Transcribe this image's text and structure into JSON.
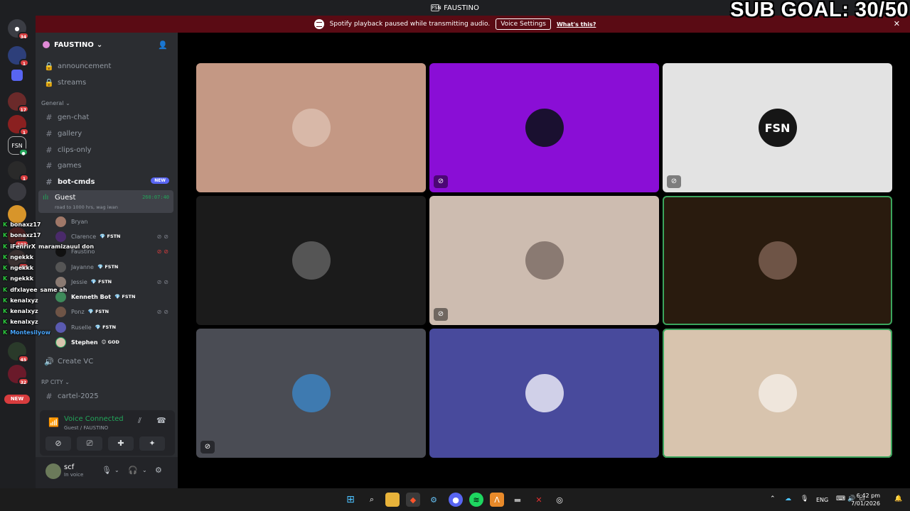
{
  "window": {
    "title": "FAUSTINO",
    "server_icon": "FSN"
  },
  "overlay": {
    "sub_goal": "SUB GOAL: 30/50"
  },
  "notice": {
    "text": "Spotify playback paused while transmitting audio.",
    "button": "Voice Settings",
    "link": "What's this?",
    "close": "✕"
  },
  "guild_rail": {
    "badges": [
      "34",
      "1",
      "17",
      "1",
      "1",
      "103",
      "27",
      "45",
      "32"
    ],
    "new_label": "NEW"
  },
  "server": {
    "name": "FAUSTINO",
    "channels_top": [
      {
        "name": "announcement",
        "icon": "lock-icon"
      },
      {
        "name": "streams",
        "icon": "lock-icon"
      }
    ],
    "category_general": "General",
    "channels_general": [
      {
        "name": "gen-chat"
      },
      {
        "name": "gallery"
      },
      {
        "name": "clips-only"
      },
      {
        "name": "games"
      },
      {
        "name": "bot-cmds",
        "tag": "NEW"
      }
    ],
    "voice_channel": {
      "name": "Guest",
      "status": "road to 1000 hrs, wag iwan",
      "timer": "260:07:40"
    },
    "voice_users": [
      {
        "name": "Bryan",
        "tag": ""
      },
      {
        "name": "Clarence",
        "tag": "FSTN"
      },
      {
        "name": "Faustino",
        "tag": ""
      },
      {
        "name": "Jayanne",
        "tag": "FSTN"
      },
      {
        "name": "Jessie",
        "tag": "FSTN"
      },
      {
        "name": "Kenneth Bot",
        "tag": "FSTN"
      },
      {
        "name": "Ponz",
        "tag": "FSTN"
      },
      {
        "name": "Ruselle",
        "tag": "FSTN"
      },
      {
        "name": "Stephen",
        "tag": "GOD"
      }
    ],
    "create_vc": "Create VC",
    "category_rp": "RP CITY",
    "channels_rp": [
      {
        "name": "cartel-2025"
      }
    ]
  },
  "chat_overlay": [
    {
      "name": "bonaxz17",
      "msg": ""
    },
    {
      "name": "bonaxz17",
      "msg": ""
    },
    {
      "name": "iFenrirX",
      "msg": "maramizauul don"
    },
    {
      "name": "ngekkk",
      "msg": ""
    },
    {
      "name": "ngekkk",
      "msg": ""
    },
    {
      "name": "ngekkk",
      "msg": ""
    },
    {
      "name": "dfxlayee",
      "msg": "same ah"
    },
    {
      "name": "kenalxyz",
      "msg": ""
    },
    {
      "name": "kenalxyz",
      "msg": ""
    },
    {
      "name": "kenalxyz",
      "msg": ""
    },
    {
      "name": "Montesilyow",
      "msg": ""
    }
  ],
  "voice_panel": {
    "status": "Voice Connected",
    "location": "Guest / FAUSTINO"
  },
  "user": {
    "name": "scf",
    "status": "In voice"
  },
  "tiles": [
    {
      "bg": "#c49884",
      "avatar_bg": "#d8b8a8",
      "label": "",
      "muted": false,
      "speaking": false
    },
    {
      "bg": "#8a0ed6",
      "avatar_bg": "#1a1030",
      "label": "",
      "muted": true,
      "speaking": false
    },
    {
      "bg": "#e3e3e3",
      "avatar_bg": "#161616",
      "label": "FSN",
      "muted": true,
      "speaking": false
    },
    {
      "bg": "#1b1b1b",
      "avatar_bg": "#555555",
      "label": "",
      "muted": false,
      "speaking": false
    },
    {
      "bg": "#cdbcb0",
      "avatar_bg": "#8a7a72",
      "label": "",
      "muted": true,
      "speaking": false
    },
    {
      "bg": "#291b0e",
      "avatar_bg": "#6e5446",
      "label": "",
      "muted": false,
      "speaking": true
    },
    {
      "bg": "#4a4c54",
      "avatar_bg": "#3e7ab0",
      "label": "",
      "muted": true,
      "speaking": false
    },
    {
      "bg": "#484a9c",
      "avatar_bg": "#d0d0e8",
      "label": "",
      "muted": false,
      "speaking": false
    },
    {
      "bg": "#d8c4ae",
      "avatar_bg": "#efe6dc",
      "label": "",
      "muted": false,
      "speaking": true
    }
  ],
  "taskbar": {
    "lang": "ENG",
    "time": "6:42 pm",
    "date": "7/01/2026"
  }
}
